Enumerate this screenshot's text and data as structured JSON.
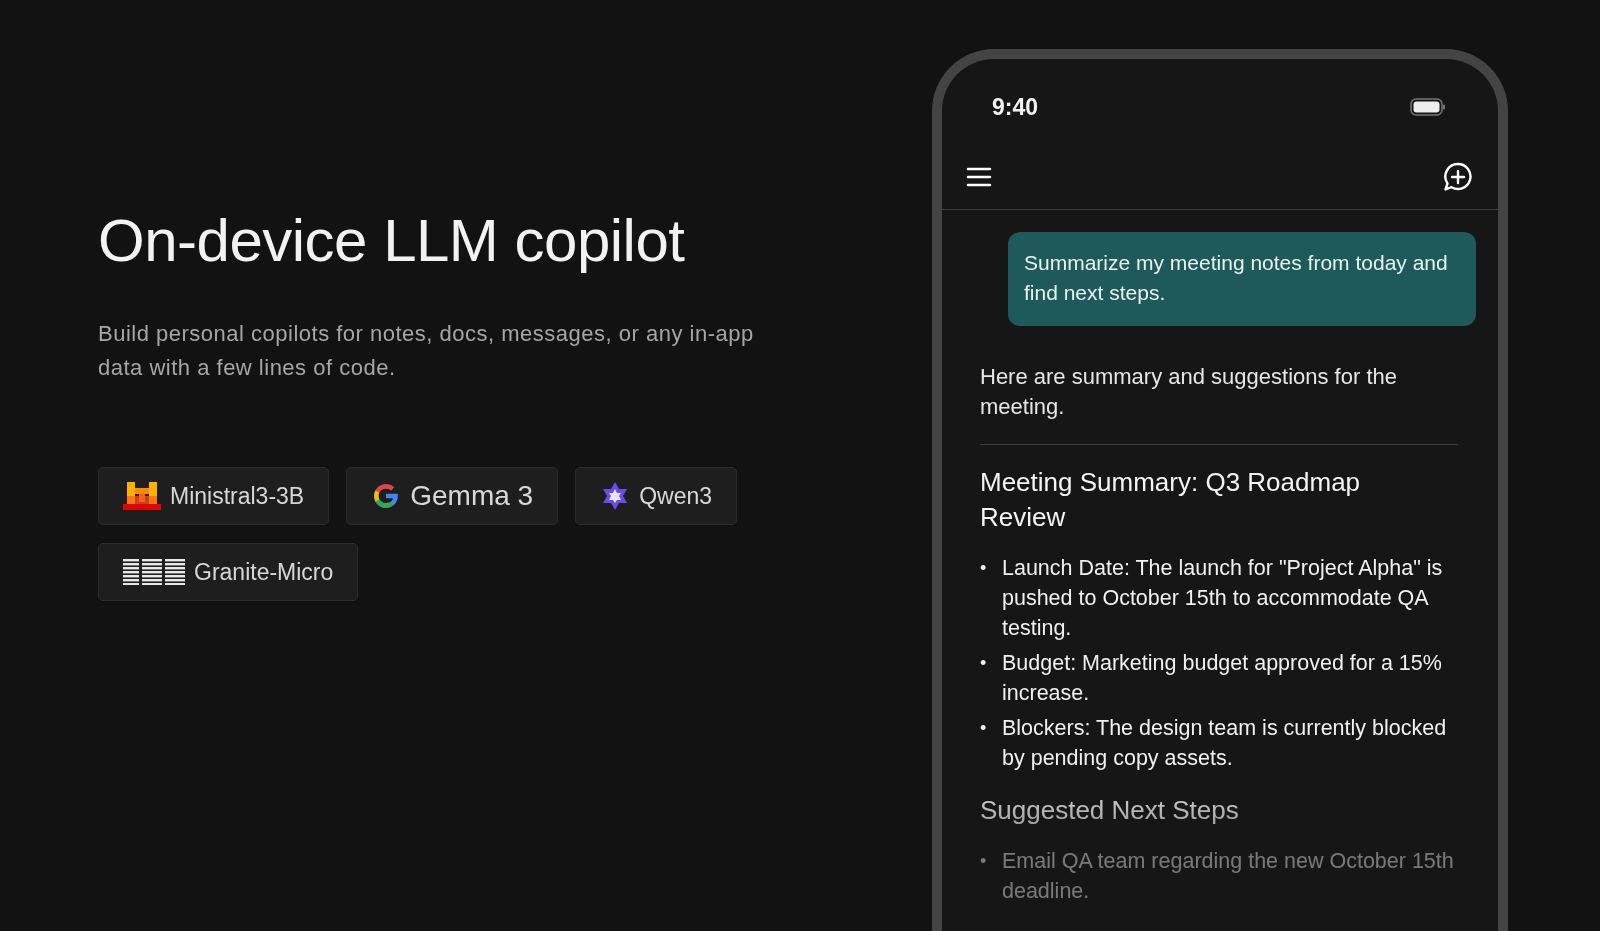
{
  "hero": {
    "title": "On-device LLM copilot",
    "description": "Build personal copilots for notes, docs, messages, or any in-app data with a few lines of code."
  },
  "models": [
    {
      "kind": "mistral",
      "label": "Ministral3-3B"
    },
    {
      "kind": "google",
      "label": "Gemma 3"
    },
    {
      "kind": "qwen",
      "label": "Qwen3"
    },
    {
      "kind": "ibm",
      "label": "Granite-Micro"
    }
  ],
  "phone": {
    "status_bar": {
      "time": "9:40"
    },
    "chat": {
      "user_message": "Summarize my meeting notes from today and find next steps.",
      "reply_intro": "Here are summary and suggestions for the meeting.",
      "sections": [
        {
          "heading": "Meeting Summary: Q3 Roadmap Review",
          "items": [
            {
              "bullet": "•",
              "text": "Launch Date: The launch for \"Project Alpha\" is pushed to October 15th to accommodate QA testing."
            },
            {
              "bullet": "•",
              "text": "Budget: Marketing budget approved for a 15% increase."
            },
            {
              "bullet": "•",
              "text": "Blockers: The design team is currently blocked by pending copy assets."
            }
          ]
        },
        {
          "heading": "Suggested Next Steps",
          "items": [
            {
              "bullet": "•",
              "text": "Email QA team regarding the new October 15th deadline."
            }
          ]
        }
      ]
    }
  }
}
